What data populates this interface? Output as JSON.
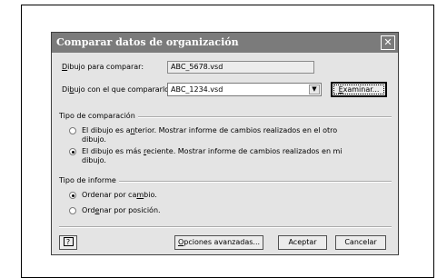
{
  "dialog": {
    "title": "Comparar datos de organización",
    "close_glyph": "✕"
  },
  "fields": {
    "compare_label": [
      "D",
      "ibujo para comparar:"
    ],
    "compare_value": "ABC_5678.vsd",
    "with_label": [
      "Di",
      "b",
      "ujo con el que compararlo:"
    ],
    "with_value": "ABC_1234.vsd",
    "browse_button": [
      "",
      "E",
      "xaminar..."
    ]
  },
  "comparison_type": {
    "title": "Tipo de comparación",
    "options": [
      {
        "text": [
          "El dibujo es a",
          "n",
          "terior. Mostrar informe de cambios realizados en el otro"
        ],
        "text2": "dibujo.",
        "selected": false
      },
      {
        "text": [
          "El dibujo es más ",
          "r",
          "eciente. Mostrar informe de cambios realizados en mi"
        ],
        "text2": "dibujo.",
        "selected": true
      }
    ]
  },
  "report_type": {
    "title": "Tipo de informe",
    "options": [
      {
        "text": [
          "Ordenar por ca",
          "m",
          "bio."
        ],
        "selected": true
      },
      {
        "text": [
          "Ord",
          "e",
          "nar por posición."
        ],
        "selected": false
      }
    ]
  },
  "footer": {
    "help_glyph": "?",
    "advanced_button": [
      "",
      "O",
      "pciones avanzadas..."
    ],
    "accept_button": "Aceptar",
    "cancel_button": "Cancelar"
  },
  "colors": {
    "titlebar": "#7b7b7b",
    "dialog_bg": "#e4e4e4"
  },
  "icons": {
    "close": "close-icon",
    "help": "help-icon",
    "combo_arrow": "chevron-down-icon"
  }
}
